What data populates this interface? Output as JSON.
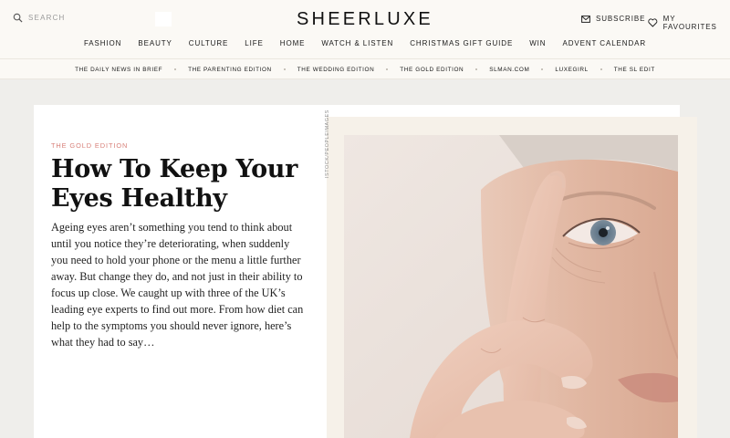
{
  "header": {
    "search_label": "SEARCH",
    "logo": "SHEERLUXE",
    "subscribe_label": "SUBSCRIBE",
    "favourites_label": "MY FAVOURITES"
  },
  "main_nav": [
    "FASHION",
    "BEAUTY",
    "CULTURE",
    "LIFE",
    "HOME",
    "WATCH & LISTEN",
    "CHRISTMAS GIFT GUIDE",
    "WIN",
    "ADVENT CALENDAR"
  ],
  "sub_nav": [
    "THE DAILY NEWS IN BRIEF",
    "THE PARENTING EDITION",
    "THE WEDDING EDITION",
    "THE GOLD EDITION",
    "SLMAN.COM",
    "LUXEGIRL",
    "THE SL EDIT"
  ],
  "article": {
    "kicker": "THE GOLD EDITION",
    "title": "How To Keep Your Eyes Healthy",
    "excerpt": "Ageing eyes aren’t something you tend to think about until you notice they’re deteriorating, when suddenly you need to hold your phone or the menu a little further away. But change they do, and not just in their ability to focus up close. We caught up with three of the UK’s leading eye experts to find out more. From how diet can help to the symptoms you should never ignore, here’s what they had to say…",
    "image_credit": "ISTOCK/PEOPLEIMAGES"
  },
  "colors": {
    "header_bg": "#fbf9f5",
    "page_bg": "#efeeeb",
    "accent": "#d88079"
  }
}
